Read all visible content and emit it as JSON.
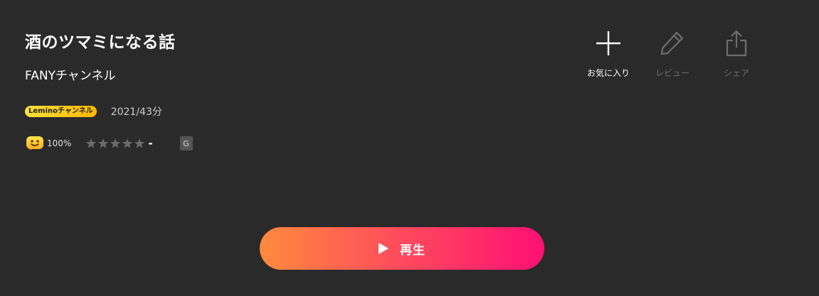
{
  "content": {
    "title": "酒のツマミになる話",
    "channel": "FANYチャンネル",
    "badge": "Leminoチャンネル",
    "year_duration": "2021/43分",
    "like_percent": "100%",
    "star_score": "-",
    "rating_stars_filled": 0,
    "age_rating": "G"
  },
  "actions": {
    "favorite_label": "お気に入り",
    "review_label": "レビュー",
    "share_label": "シェア"
  },
  "play": {
    "label": "再生"
  },
  "colors": {
    "background": "#2a2a2a",
    "badge_yellow": "#ffcc1a",
    "play_gradient_start": "#ff8a3d",
    "play_gradient_end": "#ff1073",
    "disabled_gray": "#6e6e6e",
    "star_gray": "#6a6a6a"
  },
  "icons": {
    "favorite": "plus-icon",
    "review": "pencil-icon",
    "share": "share-icon",
    "play": "play-icon",
    "like": "smiley-face-icon",
    "star": "star-icon"
  }
}
